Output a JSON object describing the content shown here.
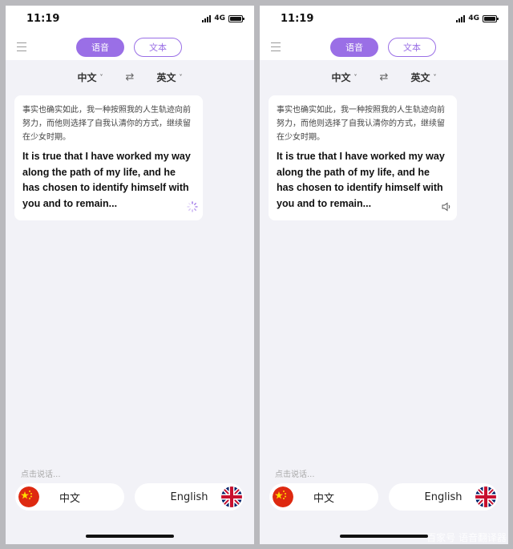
{
  "screens": [
    {
      "status": {
        "time": "11:19",
        "network": "4G"
      },
      "tabs": {
        "voice": "语音",
        "text": "文本"
      },
      "lang_row": {
        "source": "中文",
        "target": "英文"
      },
      "card": {
        "source_text": "事实也确实如此，我一种按照我的人生轨迹向前努力，而他则选择了自我认清你的方式，继续留在少女时期。",
        "target_text": "It is true that I have worked my way along the path of my life, and he has chosen to identify himself with you and to remain..."
      },
      "hint": "点击说话...",
      "buttons": {
        "chinese": "中文",
        "english": "English"
      },
      "card_status_icon": "loading-spinner-icon"
    },
    {
      "status": {
        "time": "11:19",
        "network": "4G"
      },
      "tabs": {
        "voice": "语音",
        "text": "文本"
      },
      "lang_row": {
        "source": "中文",
        "target": "英文"
      },
      "card": {
        "source_text": "事实也确实如此，我一种按照我的人生轨迹向前努力，而他则选择了自我认清你的方式，继续留在少女时期。",
        "target_text": "It is true that I have worked my way along the path of my life, and he has chosen to identify himself with you and to remain..."
      },
      "hint": "点击说话...",
      "buttons": {
        "chinese": "中文",
        "english": "English"
      },
      "card_status_icon": "speaker-icon"
    }
  ],
  "colors": {
    "accent": "#9a6fe6",
    "background": "#f2f2f7"
  },
  "watermark": "百家号 语音翻译器"
}
